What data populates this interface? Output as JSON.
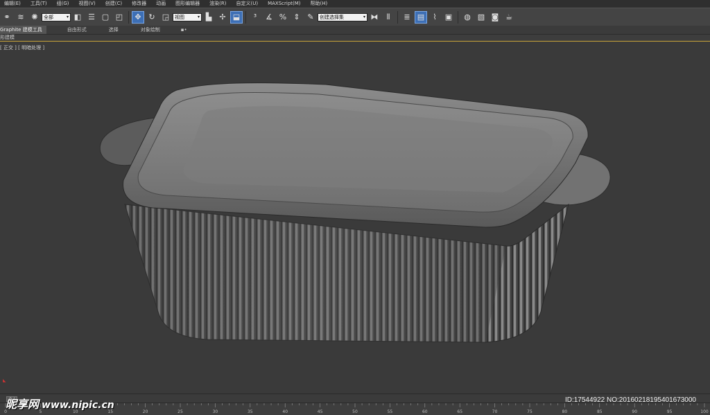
{
  "menu": {
    "items": [
      "编辑(E)",
      "工具(T)",
      "组(G)",
      "视图(V)",
      "创建(C)",
      "修改器",
      "动画",
      "图形编辑器",
      "渲染(R)",
      "自定义(U)",
      "MAXScript(M)",
      "帮助(H)"
    ]
  },
  "toolbar": {
    "selection_filter": "全部",
    "ref_coord": "视图",
    "named_selection": "创建选择集"
  },
  "ribbon": {
    "tabs": [
      "Graphite 建模工具",
      "自由形式",
      "选择",
      "对象绘制"
    ],
    "extra": "▪•"
  },
  "subbar": {
    "label": "形建模"
  },
  "viewport": {
    "label": "[ 正交 ] [ 明暗处理 ]"
  },
  "timeline": {
    "frame_label": "0 / 100",
    "ticks": [
      "0",
      "5",
      "10",
      "15",
      "20",
      "25",
      "30",
      "35",
      "40",
      "45",
      "50",
      "55",
      "60",
      "65",
      "70",
      "75",
      "80",
      "85",
      "90",
      "95",
      "100"
    ]
  },
  "watermark": {
    "brand": "昵享网",
    "site": "www.nipic.cn",
    "id": "ID:17544922 NO:20160218195401673000"
  },
  "colors": {
    "accent": "#3d6fb5",
    "viewport_bg": "#3a3a3a",
    "highlight_line": "#c8a33a"
  }
}
